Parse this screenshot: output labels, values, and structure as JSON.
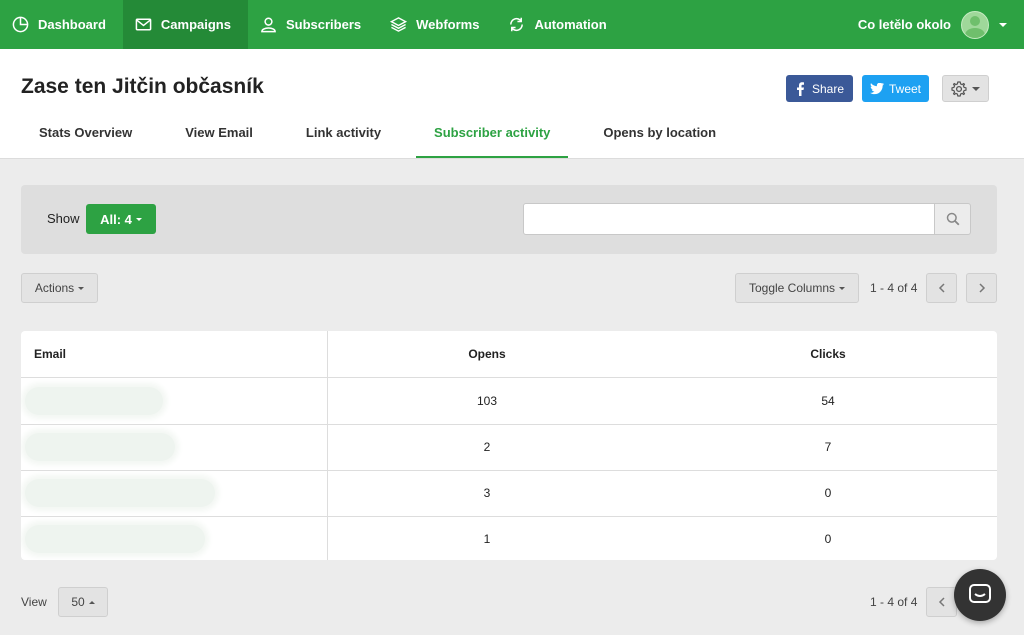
{
  "nav": {
    "items": [
      {
        "label": "Dashboard",
        "icon": "pie-chart-icon"
      },
      {
        "label": "Campaigns",
        "icon": "envelope-icon"
      },
      {
        "label": "Subscribers",
        "icon": "user-icon"
      },
      {
        "label": "Webforms",
        "icon": "layers-icon"
      },
      {
        "label": "Automation",
        "icon": "refresh-icon"
      }
    ],
    "user_name": "Co letělo okolo"
  },
  "header": {
    "title": "Zase ten Jitčin občasník",
    "share_label": "Share",
    "tweet_label": "Tweet",
    "tabs": [
      {
        "label": "Stats Overview"
      },
      {
        "label": "View Email"
      },
      {
        "label": "Link activity"
      },
      {
        "label": "Subscriber activity"
      },
      {
        "label": "Opens by location"
      }
    ]
  },
  "filter": {
    "show_label": "Show",
    "all_label": "All: 4",
    "search_value": ""
  },
  "toolbar": {
    "actions_label": "Actions",
    "toggle_label": "Toggle Columns",
    "pagination": "1 - 4 of 4"
  },
  "table": {
    "headers": {
      "email": "Email",
      "opens": "Opens",
      "clicks": "Clicks"
    },
    "rows": [
      {
        "opens": "103",
        "clicks": "54"
      },
      {
        "opens": "2",
        "clicks": "7"
      },
      {
        "opens": "3",
        "clicks": "0"
      },
      {
        "opens": "1",
        "clicks": "0"
      }
    ]
  },
  "footer": {
    "view_label": "View",
    "per_page": "50",
    "pagination": "1 - 4 of 4"
  },
  "colors": {
    "brand": "#2da243",
    "facebook": "#3b5998",
    "twitter": "#1da1f2"
  }
}
